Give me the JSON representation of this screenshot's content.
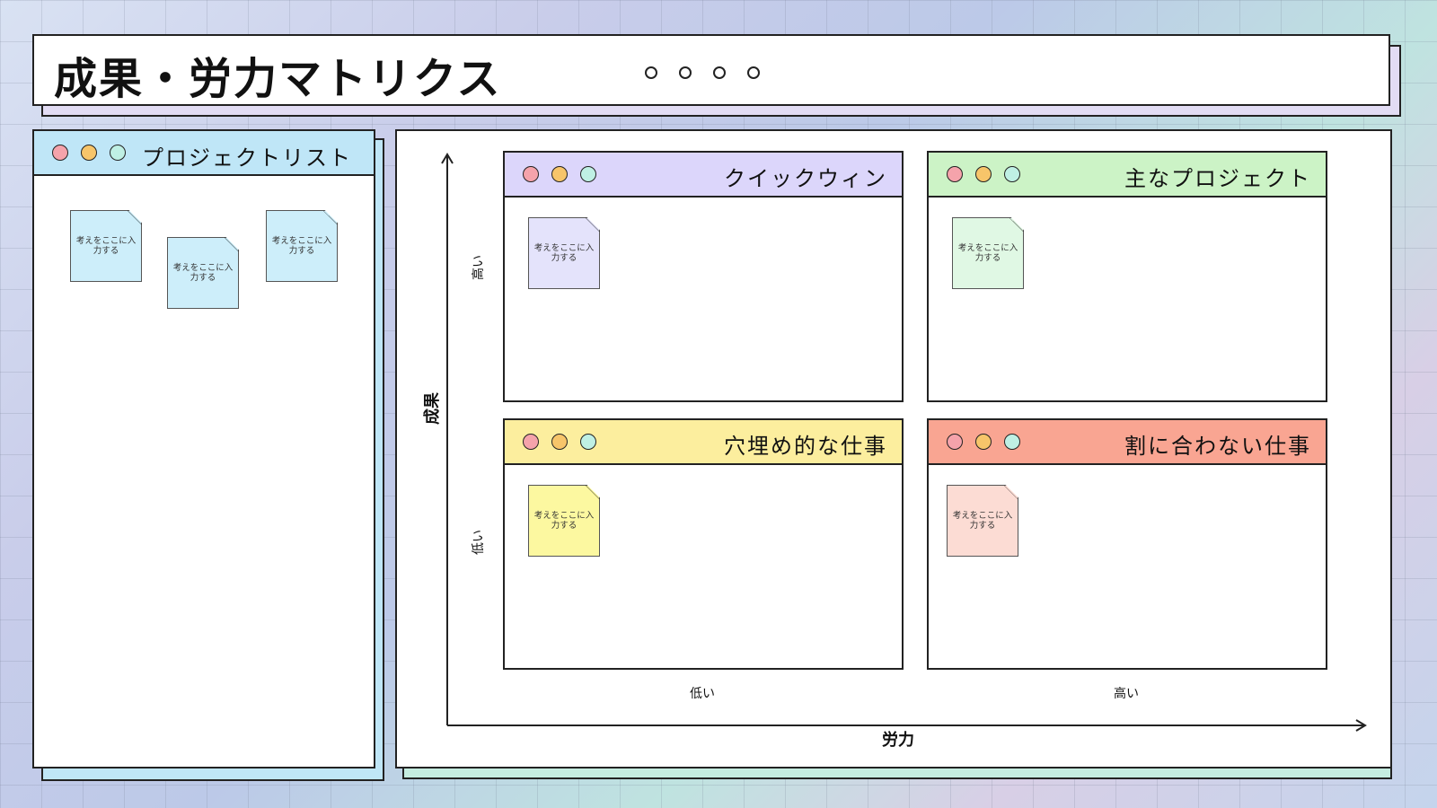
{
  "page": {
    "title": "成果・労力マトリクス"
  },
  "project_list": {
    "title": "プロジェクトリスト",
    "notes": [
      {
        "text": "考えをここに入力する",
        "color": "#cdeefa"
      },
      {
        "text": "考えをここに入力する",
        "color": "#cdeefa"
      },
      {
        "text": "考えをここに入力する",
        "color": "#cdeefa"
      }
    ]
  },
  "window_dot_colors": [
    "#f5a3ab",
    "#f7c56a",
    "#bff0e4"
  ],
  "matrix": {
    "y_axis_title": "成果",
    "x_axis_title": "労力",
    "y_high": "高い",
    "y_low": "低い",
    "x_low": "低い",
    "x_high": "高い",
    "quadrants": [
      {
        "title": "クイックウィン",
        "header_color": "#dcd6fb",
        "note": {
          "text": "考えをここに入力する",
          "color": "#e4e3fb"
        }
      },
      {
        "title": "主なプロジェクト",
        "header_color": "#ccf3c6",
        "note": {
          "text": "考えをここに入力する",
          "color": "#e0f8e4"
        }
      },
      {
        "title": "穴埋め的な仕事",
        "header_color": "#fcee9e",
        "note": {
          "text": "考えをここに入力する",
          "color": "#fcf8a0"
        }
      },
      {
        "title": "割に合わない仕事",
        "header_color": "#f9a592",
        "note": {
          "text": "考えをここに入力する",
          "color": "#fcdcd4"
        }
      }
    ]
  }
}
